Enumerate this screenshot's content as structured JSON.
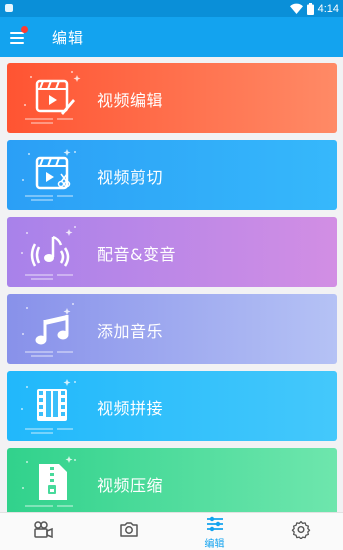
{
  "status_bar": {
    "time": "4:14"
  },
  "app_bar": {
    "title": "编辑",
    "menu_icon": "hamburger-menu-icon",
    "has_notification": true
  },
  "cards": [
    {
      "label": "视频编辑",
      "icon": "video-edit-icon",
      "gradient": [
        "#ff5432",
        "#ff8a66"
      ]
    },
    {
      "label": "视频剪切",
      "icon": "video-cut-icon",
      "gradient": [
        "#2b9ff6",
        "#36b8fb"
      ]
    },
    {
      "label": "配音&变音",
      "icon": "dubbing-music-icon",
      "gradient": [
        "#a882ea",
        "#d28ee4"
      ]
    },
    {
      "label": "添加音乐",
      "icon": "music-note-icon",
      "gradient": [
        "#8891ea",
        "#b5c2f5"
      ]
    },
    {
      "label": "视频拼接",
      "icon": "film-strip-icon",
      "gradient": [
        "#21b8fb",
        "#44c8fb"
      ]
    },
    {
      "label": "视频压缩",
      "icon": "compress-file-icon",
      "gradient": [
        "#31d28c",
        "#6ee6ad"
      ]
    }
  ],
  "bottom_nav": {
    "active_color": "#13a3ef",
    "inactive_color": "#555555",
    "items": [
      {
        "icon": "video-camera-icon",
        "label": "",
        "active": false
      },
      {
        "icon": "camera-icon",
        "label": "",
        "active": false
      },
      {
        "icon": "sliders-icon",
        "label": "编辑",
        "active": true
      },
      {
        "icon": "gear-icon",
        "label": "",
        "active": false
      }
    ]
  }
}
